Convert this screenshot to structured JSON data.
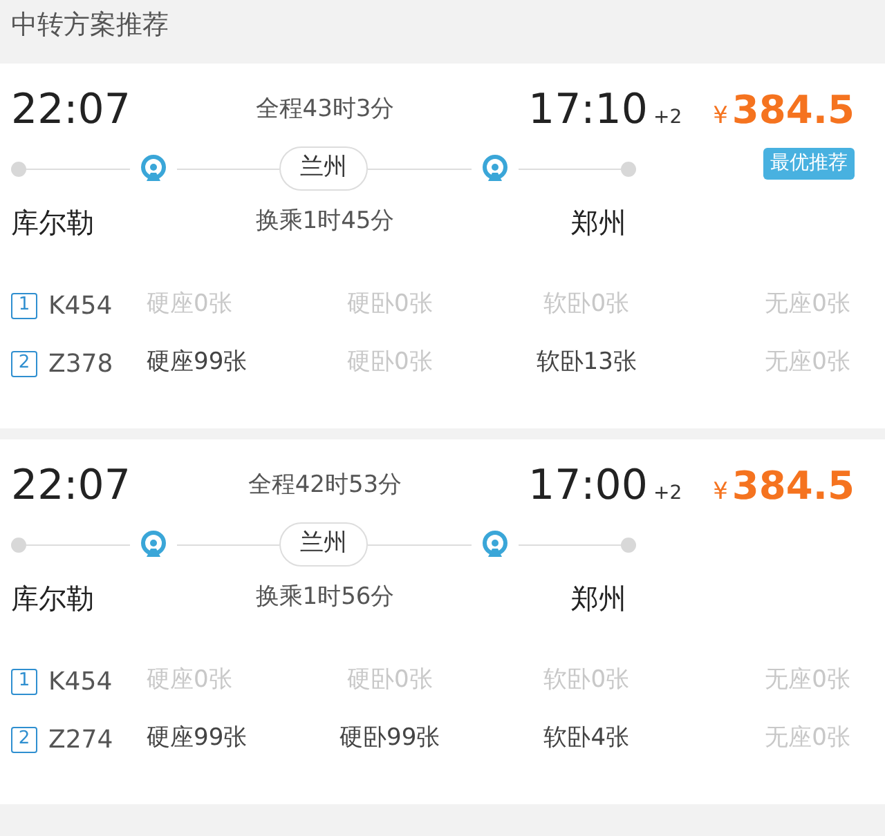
{
  "section_title": "中转方案推荐",
  "plans": [
    {
      "depart_time": "22:07",
      "total_duration": "全程43时3分",
      "arrive_time": "17:10",
      "day_offset": "+2",
      "currency": "¥",
      "price": "384.5",
      "badge": "最优推荐",
      "transfer_station": "兰州",
      "from_station": "库尔勒",
      "transfer_wait": "换乘1时45分",
      "to_station": "郑州",
      "trains": [
        {
          "index": "1",
          "code": "K454",
          "seats": [
            {
              "text": "硬座0张",
              "available": false
            },
            {
              "text": "硬卧0张",
              "available": false
            },
            {
              "text": "软卧0张",
              "available": false
            },
            {
              "text": "无座0张",
              "available": false
            }
          ]
        },
        {
          "index": "2",
          "code": "Z378",
          "seats": [
            {
              "text": "硬座99张",
              "available": true
            },
            {
              "text": "硬卧0张",
              "available": false
            },
            {
              "text": "软卧13张",
              "available": true
            },
            {
              "text": "无座0张",
              "available": false
            }
          ]
        }
      ]
    },
    {
      "depart_time": "22:07",
      "total_duration": "全程42时53分",
      "arrive_time": "17:00",
      "day_offset": "+2",
      "currency": "¥",
      "price": "384.5",
      "transfer_station": "兰州",
      "from_station": "库尔勒",
      "transfer_wait": "换乘1时56分",
      "to_station": "郑州",
      "trains": [
        {
          "index": "1",
          "code": "K454",
          "seats": [
            {
              "text": "硬座0张",
              "available": false
            },
            {
              "text": "硬卧0张",
              "available": false
            },
            {
              "text": "软卧0张",
              "available": false
            },
            {
              "text": "无座0张",
              "available": false
            }
          ]
        },
        {
          "index": "2",
          "code": "Z274",
          "seats": [
            {
              "text": "硬座99张",
              "available": true
            },
            {
              "text": "硬卧99张",
              "available": true
            },
            {
              "text": "软卧4张",
              "available": true
            },
            {
              "text": "无座0张",
              "available": false
            }
          ]
        }
      ]
    }
  ]
}
